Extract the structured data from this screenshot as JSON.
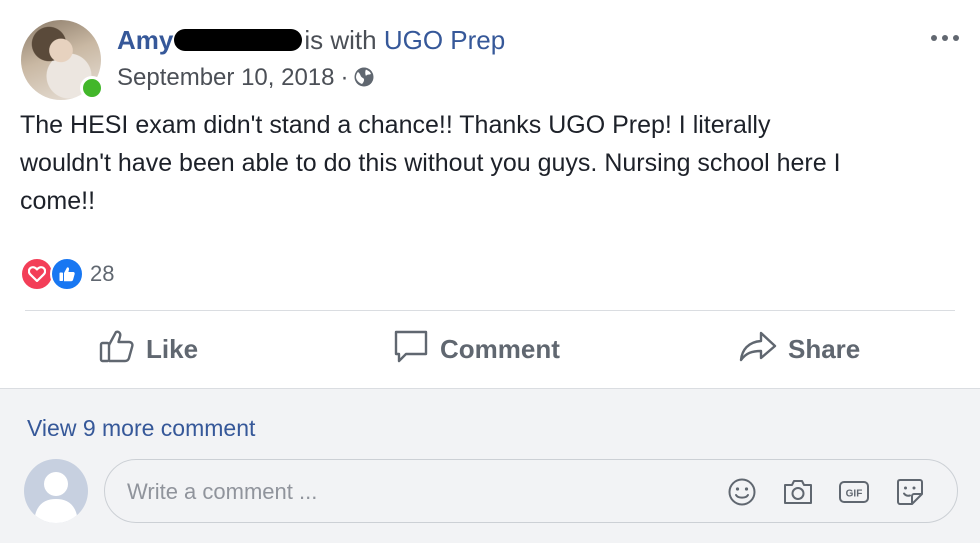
{
  "post": {
    "author_first_name": "Amy",
    "with_text": "is with",
    "tagged_page": "UGO Prep",
    "date": "September 10, 2018",
    "date_separator": "·",
    "privacy_icon": "globe-icon",
    "more_icon": "more-options-icon",
    "body": "The HESI exam didn't stand a chance!! Thanks UGO Prep! I literally\nwouldn't have been able to do this without you guys. Nursing school here I\ncome!!",
    "reactions": {
      "types": [
        "love",
        "like"
      ],
      "count": "28",
      "colors": {
        "love": "#f33e58",
        "like": "#1877f2"
      }
    }
  },
  "actions": {
    "like_label": "Like",
    "comment_label": "Comment",
    "share_label": "Share"
  },
  "comments": {
    "view_more_label": "View 9 more comment",
    "input_placeholder": "Write a comment ...",
    "icons": [
      "emoji-icon",
      "camera-icon",
      "gif-icon",
      "sticker-icon"
    ]
  },
  "colors": {
    "link_blue": "#365899",
    "secondary_text": "#606770",
    "online_green": "#42b72a",
    "comment_bg": "#f2f3f5"
  }
}
